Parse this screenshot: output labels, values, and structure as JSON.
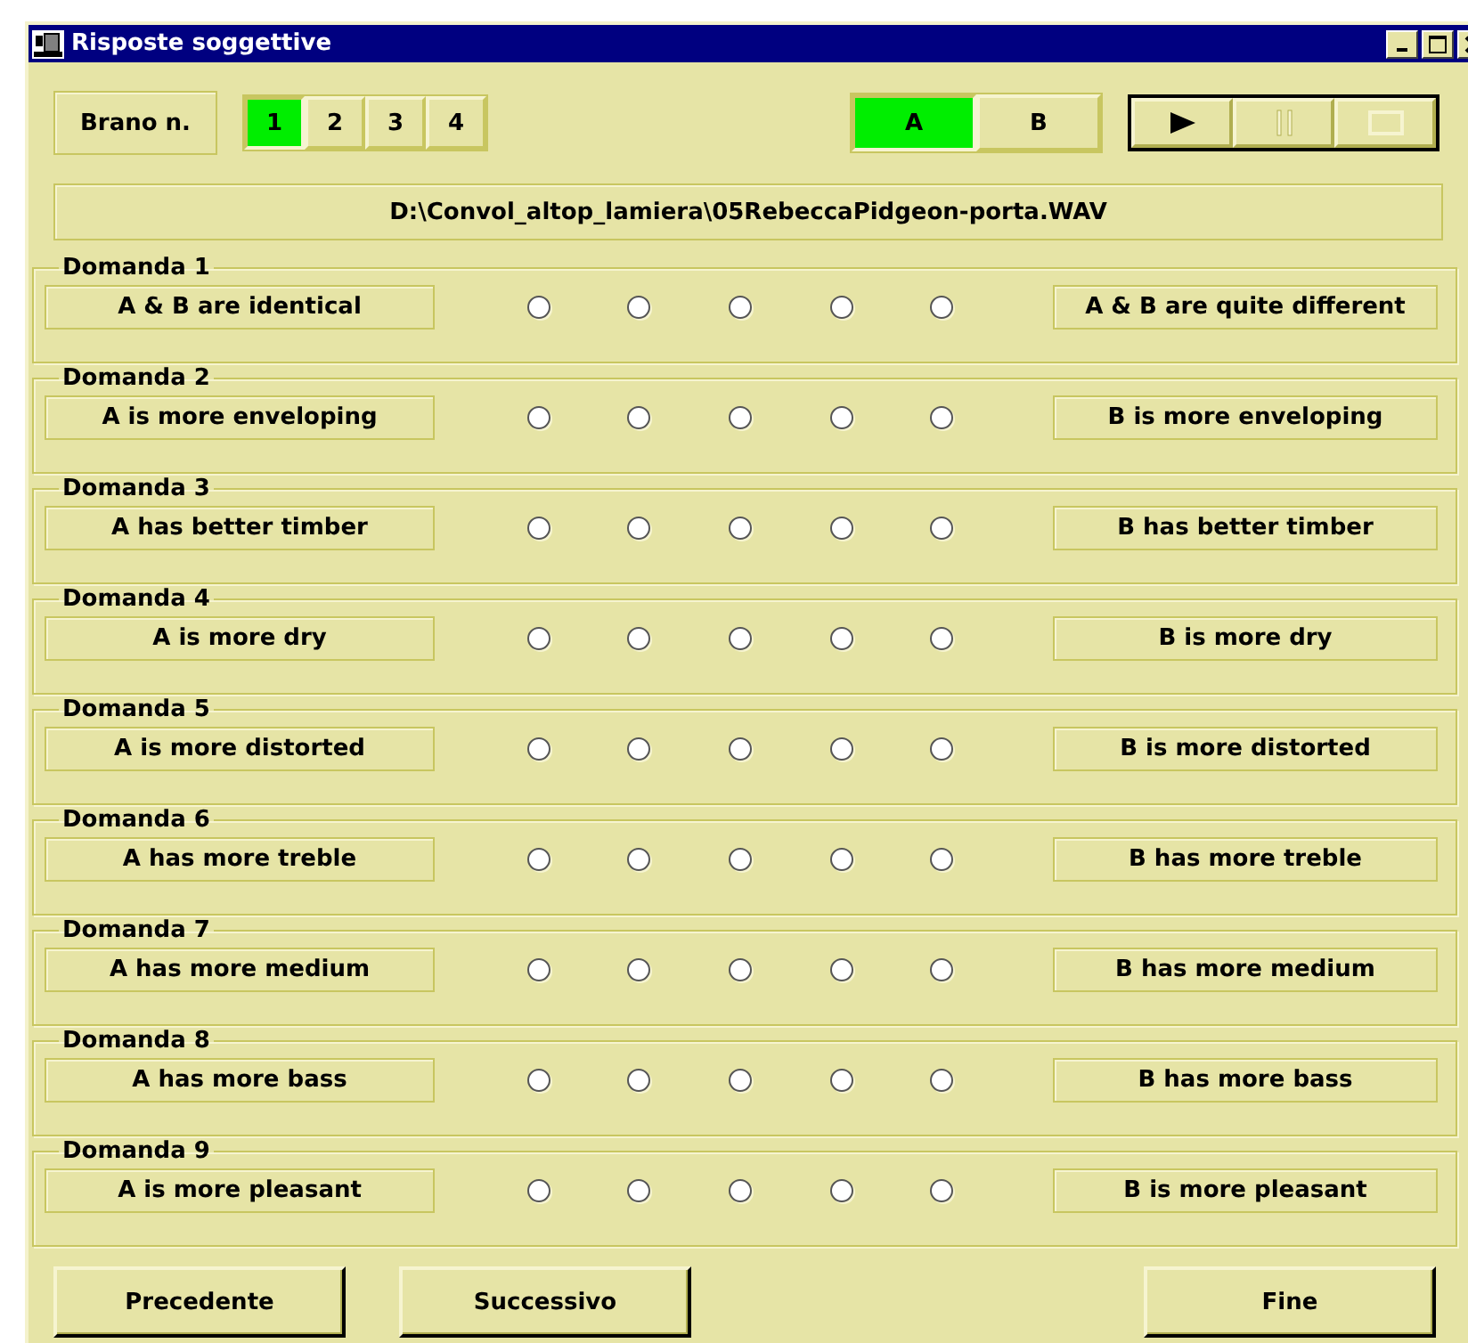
{
  "window": {
    "title": "Risposte soggettive"
  },
  "track_label": "Brano n.",
  "tracks": [
    {
      "label": "1",
      "selected": true
    },
    {
      "label": "2",
      "selected": false
    },
    {
      "label": "3",
      "selected": false
    },
    {
      "label": "4",
      "selected": false
    }
  ],
  "versions": [
    {
      "label": "A",
      "selected": true
    },
    {
      "label": "B",
      "selected": false
    }
  ],
  "transport": [
    {
      "kind": "play",
      "disabled": false
    },
    {
      "kind": "pause",
      "disabled": true
    },
    {
      "kind": "stop",
      "disabled": true
    }
  ],
  "file_path": "D:\\Convol_altop_lamiera\\05RebeccaPidgeon-porta.WAV",
  "questions": [
    {
      "title": "Domanda 1",
      "left": "A & B are identical",
      "right": "A & B are quite different",
      "options": [
        {
          "selected": false
        },
        {
          "selected": false
        },
        {
          "selected": false
        },
        {
          "selected": false
        },
        {
          "selected": false
        }
      ]
    },
    {
      "title": "Domanda 2",
      "left": "A is more enveloping",
      "right": "B is more enveloping",
      "options": [
        {
          "selected": false
        },
        {
          "selected": false
        },
        {
          "selected": false
        },
        {
          "selected": false
        },
        {
          "selected": false
        }
      ]
    },
    {
      "title": "Domanda 3",
      "left": "A has better timber",
      "right": "B has better timber",
      "options": [
        {
          "selected": false
        },
        {
          "selected": false
        },
        {
          "selected": false
        },
        {
          "selected": false
        },
        {
          "selected": false
        }
      ]
    },
    {
      "title": "Domanda 4",
      "left": "A is more dry",
      "right": "B is more dry",
      "options": [
        {
          "selected": false
        },
        {
          "selected": false
        },
        {
          "selected": false
        },
        {
          "selected": false
        },
        {
          "selected": false
        }
      ]
    },
    {
      "title": "Domanda 5",
      "left": "A is more distorted",
      "right": "B is more distorted",
      "options": [
        {
          "selected": false
        },
        {
          "selected": false
        },
        {
          "selected": false
        },
        {
          "selected": false
        },
        {
          "selected": false
        }
      ]
    },
    {
      "title": "Domanda 6",
      "left": "A has more treble",
      "right": "B has more treble",
      "options": [
        {
          "selected": false
        },
        {
          "selected": false
        },
        {
          "selected": false
        },
        {
          "selected": false
        },
        {
          "selected": false
        }
      ]
    },
    {
      "title": "Domanda 7",
      "left": "A has more medium",
      "right": "B has more medium",
      "options": [
        {
          "selected": false
        },
        {
          "selected": false
        },
        {
          "selected": false
        },
        {
          "selected": false
        },
        {
          "selected": false
        }
      ]
    },
    {
      "title": "Domanda 8",
      "left": "A has more bass",
      "right": "B has more bass",
      "options": [
        {
          "selected": false
        },
        {
          "selected": false
        },
        {
          "selected": false
        },
        {
          "selected": false
        },
        {
          "selected": false
        }
      ]
    },
    {
      "title": "Domanda 9",
      "left": "A is more pleasant",
      "right": "B is more pleasant",
      "options": [
        {
          "selected": false
        },
        {
          "selected": false
        },
        {
          "selected": false
        },
        {
          "selected": false
        },
        {
          "selected": false
        }
      ]
    }
  ],
  "buttons": [
    "Precedente",
    "Successivo",
    "Fine"
  ]
}
